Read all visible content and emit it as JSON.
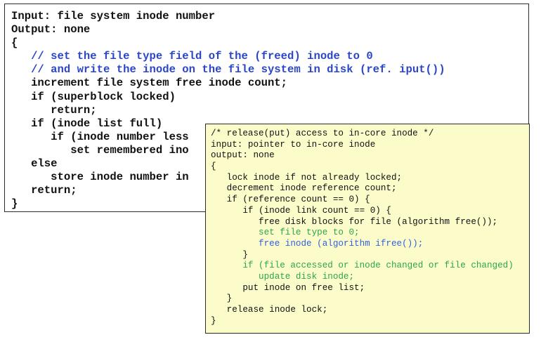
{
  "main_code": {
    "lines": [
      "Input: file system inode number",
      "Output: none",
      "{",
      "   // set the file type field of the (freed) inode to 0",
      "   // and write the inode on the file system in disk (ref. iput())",
      "   increment file system free inode count;",
      "   if (superblock locked)",
      "      return;",
      "   if (inode list full)",
      "      if (inode number less",
      "         set remembered ino",
      "   else",
      "      store inode number in",
      "   return;",
      "}"
    ]
  },
  "overlay_code": {
    "lines": [
      "/* release(put) access to in-core inode */",
      "input: pointer to in-core inode",
      "output: none",
      "{",
      "   lock inode if not already locked;",
      "   decrement inode reference count;",
      "   if (reference count == 0) {",
      "      if (inode link count == 0) {",
      "         free disk blocks for file (algorithm free());",
      "         set file type to 0;",
      "         free inode (algorithm ifree());",
      "      }",
      "      if (file accessed or inode changed or file changed)",
      "         update disk inode;",
      "      put inode on free list;",
      "   }",
      "   release inode lock;",
      "}"
    ]
  },
  "colors": {
    "comment_blue": "#2b46c8",
    "highlight_blue": "#2f5fe0",
    "highlight_green": "#2aa64a",
    "overlay_background": "#fcfccb"
  }
}
